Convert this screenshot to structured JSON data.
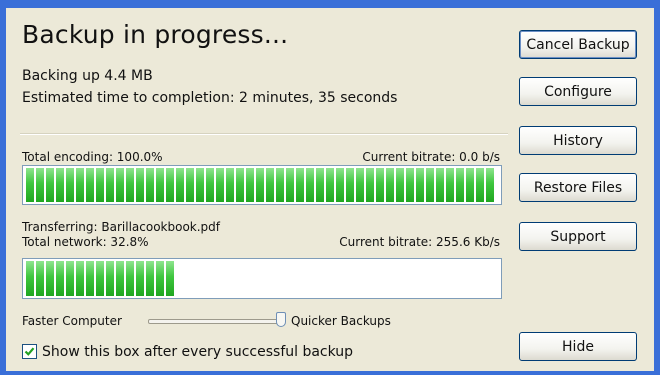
{
  "title": "Backup in progress...",
  "status": {
    "backing_up": "Backing up 4.4 MB",
    "eta": "Estimated time to completion: 2 minutes, 35 seconds"
  },
  "encoding": {
    "label": "Total encoding: 100.0%",
    "bitrate": "Current bitrate: 0.0 b/s",
    "progress": 1.0
  },
  "network": {
    "transferring": "Transferring: Barillacookbook.pdf",
    "label": "Total network: 32.8%",
    "bitrate": "Current bitrate: 255.6 Kb/s",
    "progress": 0.328
  },
  "slider": {
    "left_label": "Faster Computer",
    "right_label": "Quicker Backups",
    "value": 1.0
  },
  "checkbox": {
    "label": "Show this box after every successful backup",
    "checked": true
  },
  "buttons": {
    "cancel": "Cancel Backup",
    "configure": "Configure",
    "history": "History",
    "restore": "Restore Files",
    "support": "Support",
    "hide": "Hide"
  },
  "colors": {
    "progress_green": "#2fbf2f",
    "window_bg": "#ece9d8",
    "button_border": "#003c74"
  }
}
